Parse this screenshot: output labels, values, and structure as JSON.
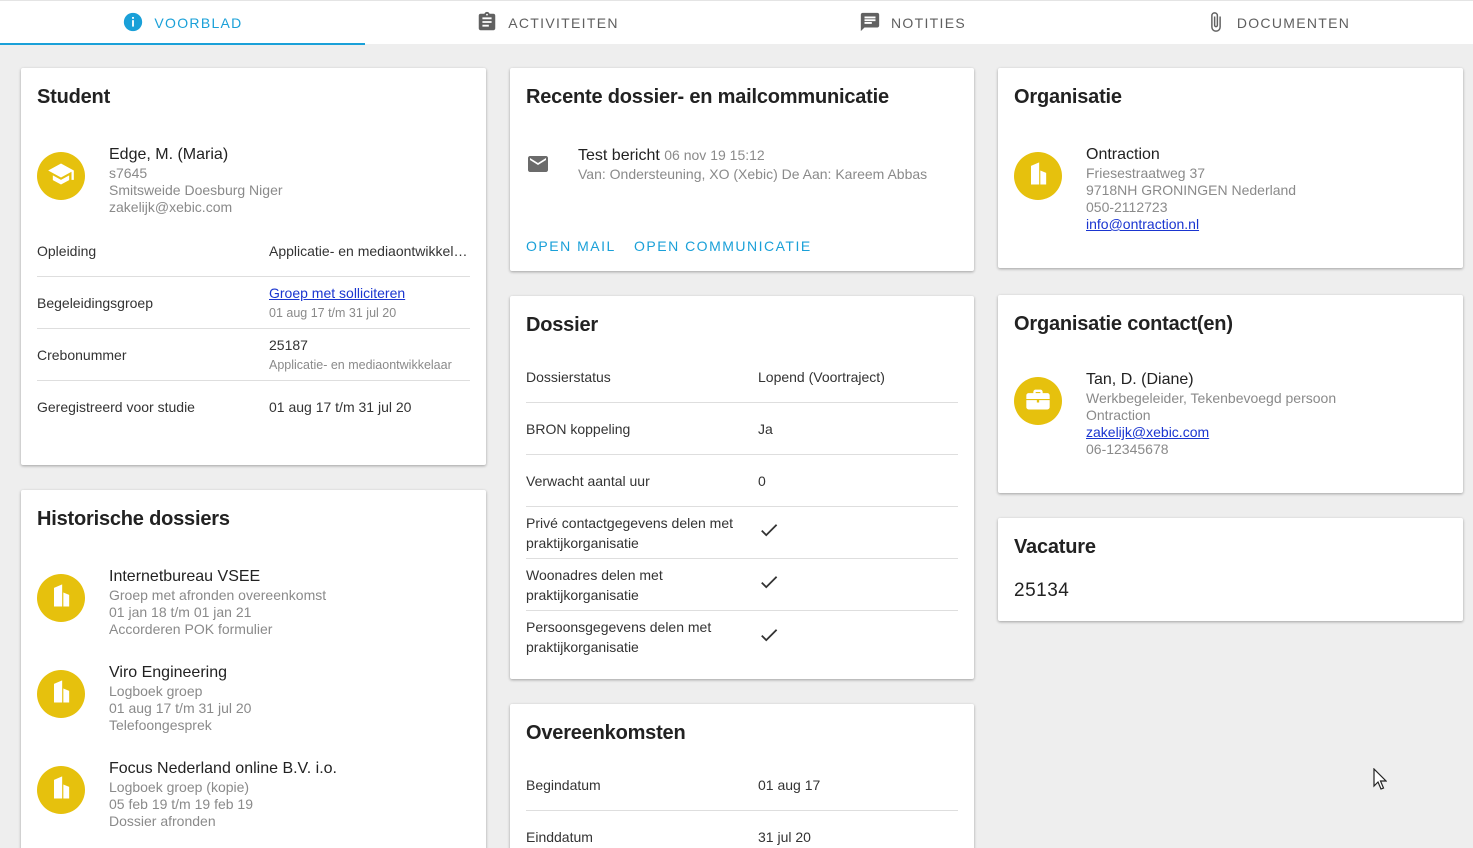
{
  "tabs": [
    {
      "label": "Voorblad",
      "icon": "info-icon",
      "active": true
    },
    {
      "label": "Activiteiten",
      "icon": "clipboard-icon",
      "active": false
    },
    {
      "label": "Notities",
      "icon": "notes-icon",
      "active": false
    },
    {
      "label": "Documenten",
      "icon": "paperclip-icon",
      "active": false
    }
  ],
  "colors": {
    "accent": "#1aa0d8",
    "avatar": "#e6c10d",
    "link": "#1a35d0"
  },
  "student": {
    "title": "Student",
    "name": "Edge, M. (Maria)",
    "number": "s7645",
    "address": "Smitsweide Doesburg Niger",
    "email": "zakelijk@xebic.com",
    "rows": [
      {
        "label": "Opleiding",
        "value": "Applicatie- en mediaontwikkelaar",
        "sub": ""
      },
      {
        "label": "Begeleidingsgroep",
        "value": "Groep met solliciteren",
        "sub": "01 aug 17 t/m 31 jul 20"
      },
      {
        "label": "Crebonummer",
        "value": "25187",
        "sub": "Applicatie- en mediaontwikkelaar"
      },
      {
        "label": "Geregistreerd voor studie",
        "value": "01 aug 17 t/m 31 jul 20",
        "sub": ""
      }
    ]
  },
  "history": {
    "title": "Historische dossiers",
    "items": [
      {
        "name": "Internetbureau VSEE",
        "line1": "Groep met afronden overeenkomst",
        "line2": "01 jan 18 t/m 01 jan 21",
        "line3": "Accorderen POK formulier"
      },
      {
        "name": "Viro Engineering",
        "line1": "Logboek groep",
        "line2": "01 aug 17 t/m 31 jul 20",
        "line3": "Telefoongesprek"
      },
      {
        "name": "Focus Nederland online B.V. i.o.",
        "line1": "Logboek groep (kopie)",
        "line2": "05 feb 19 t/m 19 feb 19",
        "line3": "Dossier afronden"
      }
    ]
  },
  "communication": {
    "title": "Recente dossier- en mailcommunicatie",
    "subject": "Test bericht",
    "date": "06 nov 19 15:12",
    "from": "Van: Ondersteuning, XO (Xebic) De Aan: Kareem Abbas",
    "open_mail": "Open mail",
    "open_communicatie": "Open communicatie"
  },
  "dossier": {
    "title": "Dossier",
    "rows": [
      {
        "label": "Dossierstatus",
        "value": "Lopend (Voortraject)"
      },
      {
        "label": "BRON koppeling",
        "value": "Ja"
      },
      {
        "label": "Verwacht aantal uur",
        "value": "0"
      },
      {
        "label": "Privé contactgegevens delen met praktijkorganisatie",
        "value": "check"
      },
      {
        "label": "Woonadres delen met praktijkorganisatie",
        "value": "check"
      },
      {
        "label": "Persoonsgegevens delen met praktijkorganisatie",
        "value": "check"
      }
    ]
  },
  "agreements": {
    "title": "Overeenkomsten",
    "rows": [
      {
        "label": "Begindatum",
        "value": "01 aug 17"
      },
      {
        "label": "Einddatum",
        "value": "31 jul 20"
      }
    ]
  },
  "organisation": {
    "title": "Organisatie",
    "name": "Ontraction",
    "street": "Friesestraatweg 37",
    "city": "9718NH GRONINGEN Nederland",
    "phone": "050-2112723",
    "email": "info@ontraction.nl"
  },
  "contact": {
    "title": "Organisatie contact(en)",
    "name": "Tan, D. (Diane)",
    "role": "Werkbegeleider, Tekenbevoegd persoon",
    "org": "Ontraction",
    "email": "zakelijk@xebic.com",
    "phone": "06-12345678"
  },
  "vacancy": {
    "title": "Vacature",
    "number": "25134"
  }
}
